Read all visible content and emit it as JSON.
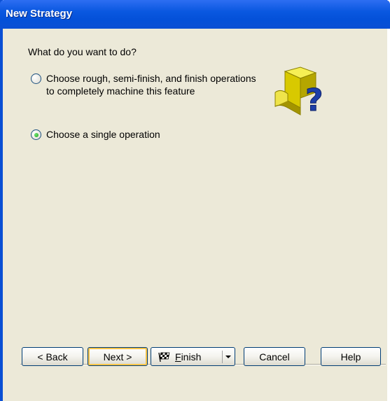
{
  "window": {
    "title": "New Strategy"
  },
  "prompt": "What do you want to do?",
  "options": [
    {
      "label": "Choose rough, semi-finish, and finish operations to completely machine this feature",
      "checked": false
    },
    {
      "label": "Choose a single operation",
      "checked": true
    }
  ],
  "buttons": {
    "back": "< Back",
    "next": "Next >",
    "finish_prefix": "",
    "finish_mnemonic": "F",
    "finish_rest": "inish",
    "cancel": "Cancel",
    "help": "Help"
  },
  "icons": {
    "illustration": "question-cube-icon",
    "finish": "checkered-flag-icon"
  },
  "colors": {
    "titlebar": "#0a4fd4",
    "dialog_bg": "#ece9d8",
    "radio_checked": "#21a121",
    "default_button_focus": "#f7c54a"
  }
}
